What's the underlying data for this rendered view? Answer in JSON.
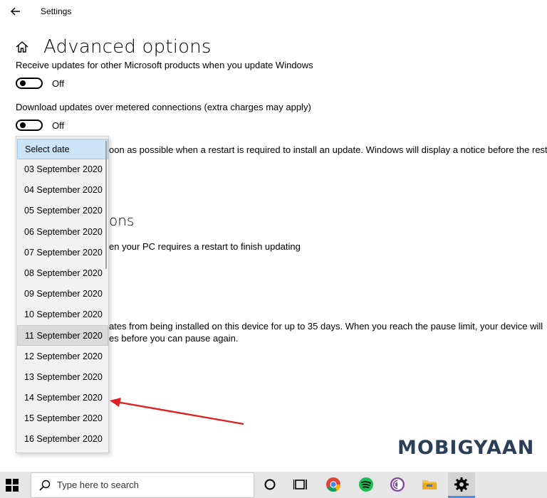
{
  "window": {
    "title": "Settings"
  },
  "header": {
    "title": "Advanced options"
  },
  "content": {
    "receive_updates_text": "Receive updates for other Microsoft products when you update Windows",
    "receive_updates_toggle": "Off",
    "metered_text": "Download updates over metered connections (extra charges may apply)",
    "metered_toggle": "Off",
    "restart_text_partial": "oon as possible when a restart is required to install an update. Windows will display a notice before the restart,",
    "notifications_heading_partial": "ons",
    "notify_text_partial": "en your PC requires a restart to finish updating",
    "pause_text_line1_partial": "ates from being installed on this device for up to 35 days. When you reach the pause limit, your device will",
    "pause_text_line2_partial": "es before you can pause again."
  },
  "dropdown": {
    "items": [
      "Select date",
      "03 September 2020",
      "04 September 2020",
      "05 September 2020",
      "06 September 2020",
      "07 September 2020",
      "08 September 2020",
      "09 September 2020",
      "10 September 2020",
      "11 September 2020",
      "12 September 2020",
      "13 September 2020",
      "14 September 2020",
      "15 September 2020",
      "16 September 2020"
    ],
    "selected_index": 0,
    "hover_index": 9
  },
  "watermark": {
    "text": "MOBIGYAAN"
  },
  "taskbar": {
    "search_placeholder": "Type here to search",
    "icons": [
      "cortana-icon",
      "task-view-icon",
      "chrome-icon",
      "spotify-icon",
      "tor-icon",
      "file-explorer-icon",
      "settings-icon"
    ]
  },
  "colors": {
    "selected_bg": "#cce4f7",
    "hover_bg": "#dadada",
    "arrow": "#e02020",
    "taskbar_bg": "#e6e6e6",
    "watermark": "#2b3f57"
  }
}
